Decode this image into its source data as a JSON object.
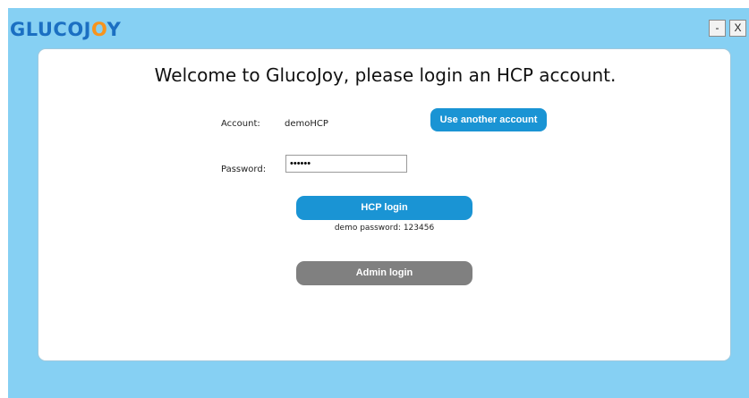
{
  "header": {
    "logo_part1": "GLUCOJ",
    "logo_accent": "O",
    "logo_part2": "Y",
    "minimize_label": "-",
    "close_label": "X"
  },
  "login": {
    "title": "Welcome to GlucoJoy, please login an HCP account.",
    "account_label": "Account:",
    "account_value": "demoHCP",
    "use_another_label": "Use another account",
    "password_label": "Password:",
    "password_value": "123456",
    "hcp_login_label": "HCP login",
    "demo_hint": "demo password: 123456",
    "admin_login_label": "Admin login"
  },
  "colors": {
    "background": "#86d0f3",
    "primary_button": "#1a94d4",
    "secondary_button": "#808080",
    "logo_blue": "#1b6fc2",
    "logo_orange": "#f7941d"
  }
}
